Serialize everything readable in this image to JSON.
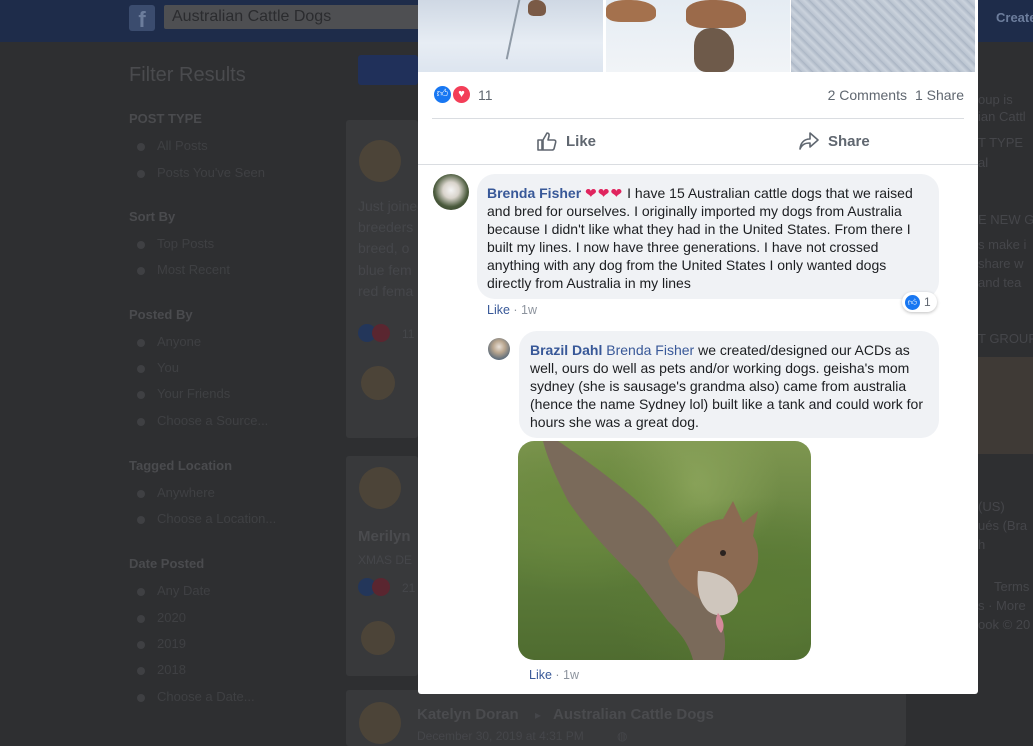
{
  "background": {
    "search_value": "Australian Cattle Dogs",
    "create_label": "Create",
    "filter_title": "Filter Results",
    "sections": [
      {
        "title": "POST TYPE",
        "options": [
          "All Posts",
          "Posts You've Seen"
        ]
      },
      {
        "title": "Sort By",
        "options": [
          "Top Posts",
          "Most Recent"
        ]
      },
      {
        "title": "Posted By",
        "options": [
          "Anyone",
          "You",
          "Your Friends",
          "Choose a Source..."
        ]
      },
      {
        "title": "Tagged Location",
        "options": [
          "Anywhere",
          "Choose a Location..."
        ]
      },
      {
        "title": "Date Posted",
        "options": [
          "Any Date",
          "2020",
          "2019",
          "2018",
          "Choose a Date..."
        ]
      }
    ],
    "feed_snippets": [
      "Just joined",
      "breeders",
      "breed, o",
      "blue fem",
      "red fema"
    ],
    "reaction_count_1": "11",
    "reaction_count_2": "21",
    "name_merilyn": "Merilyn",
    "xmas_text": "XMAS DE",
    "bottom_post": {
      "author": "Katelyn Doran",
      "group": "Australian Cattle Dogs",
      "date": "December 30, 2019 at 4:31 PM"
    },
    "right_column": [
      "oup is",
      "ian Cattl",
      "T TYPE",
      "al",
      "E NEW G",
      "s make i",
      "share w",
      "and tea",
      "T GROUP",
      "(US)",
      "ués (Bra",
      "h",
      "Terms",
      "s · More",
      "ook © 20"
    ]
  },
  "post": {
    "reactions_count": "11",
    "comments_label": "2 Comments",
    "shares_label": "1 Share",
    "like_label": "Like",
    "share_label": "Share"
  },
  "comments": [
    {
      "author": "Brenda Fisher",
      "hearts": "❤❤❤",
      "text": "I have 15 Australian cattle dogs that we raised and bred for ourselves. I originally imported my dogs from Australia because I didn't like what they had in the United States. From there I built my lines. I now have three generations. I have not crossed anything with any dog from the United States I only wanted dogs directly from Australia in my lines",
      "like_label": "Like",
      "time": "1w",
      "reaction_count": "1"
    },
    {
      "author": "Brazil Dahl",
      "mention": "Brenda Fisher",
      "text": "we created/designed our ACDs as well, ours do well as pets and/or working dogs. geisha's mom sydney (she is sausage's grandma also) came from australia (hence the name Sydney lol) built like a tank and could work for hours she was a great dog.",
      "like_label": "Like",
      "time": "1w"
    }
  ],
  "colors": {
    "link_blue": "#385898",
    "like_blue": "#1877f2",
    "love_red": "#f33e58"
  }
}
